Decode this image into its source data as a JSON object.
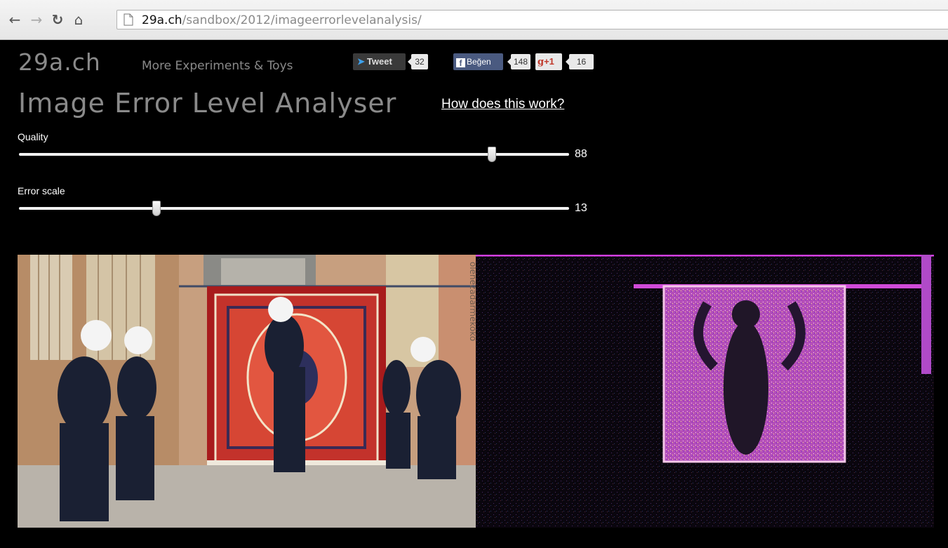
{
  "browser": {
    "url_host": "29a.ch",
    "url_path": "/sandbox/2012/imageerrorlevelanalysis/"
  },
  "header": {
    "logo": "29a.ch",
    "tagline": "More Experiments & Toys",
    "tweet_label": "Tweet",
    "tweet_count": "32",
    "like_label": "Beğen",
    "like_count": "148",
    "gplus_label": "+1",
    "gplus_count": "16"
  },
  "page": {
    "title": "Image Error Level Analyser",
    "help_link": "How does this work?"
  },
  "controls": {
    "quality": {
      "label": "Quality",
      "value": "88",
      "fraction": 0.86
    },
    "error_scale": {
      "label": "Error scale",
      "value": "13",
      "fraction": 0.25
    }
  },
  "images": {
    "photo_watermark": "olenezadarmekoko"
  },
  "colors": {
    "background": "#000000",
    "heading_gray": "#8a8a8a",
    "rug_red": "#b8211f",
    "ela_magenta": "#e14fd8"
  }
}
